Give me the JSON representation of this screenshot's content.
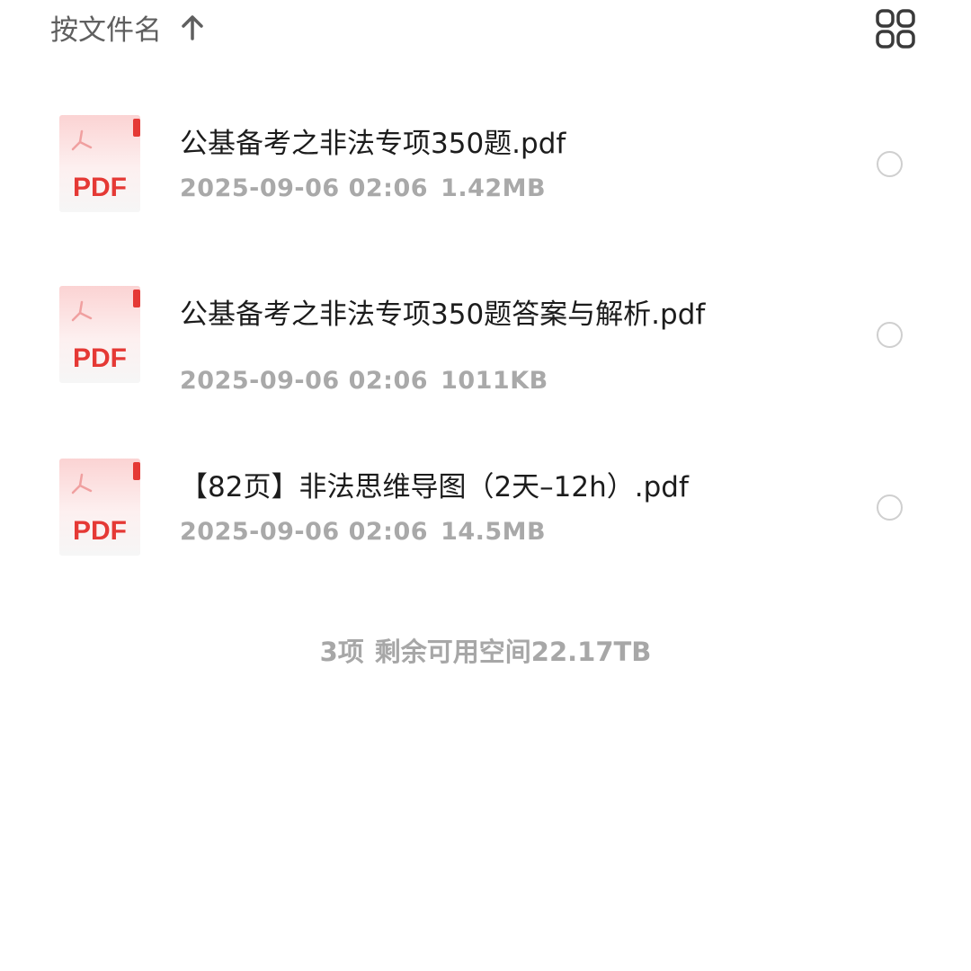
{
  "header": {
    "sort_label": "按文件名",
    "sort_direction_icon": "arrow-up-icon",
    "view_toggle_icon": "grid-view-icon"
  },
  "files": [
    {
      "icon_label": "PDF",
      "name": "公基备考之非法专项350题.pdf",
      "date": "2025-09-06 02:06",
      "size": "1.42MB"
    },
    {
      "icon_label": "PDF",
      "name": "公基备考之非法专项350题答案与解析.pdf",
      "date": "2025-09-06 02:06",
      "size": "1011KB"
    },
    {
      "icon_label": "PDF",
      "name": "【82页】非法思维导图（2天–12h）.pdf",
      "date": "2025-09-06 02:06",
      "size": "14.5MB"
    }
  ],
  "footer": {
    "count": "3项",
    "free_space": "剩余可用空间22.17TB"
  },
  "colors": {
    "pdf_red": "#e53935",
    "meta_gray": "#a9a9a9",
    "text_dark": "#1c1c1c"
  }
}
